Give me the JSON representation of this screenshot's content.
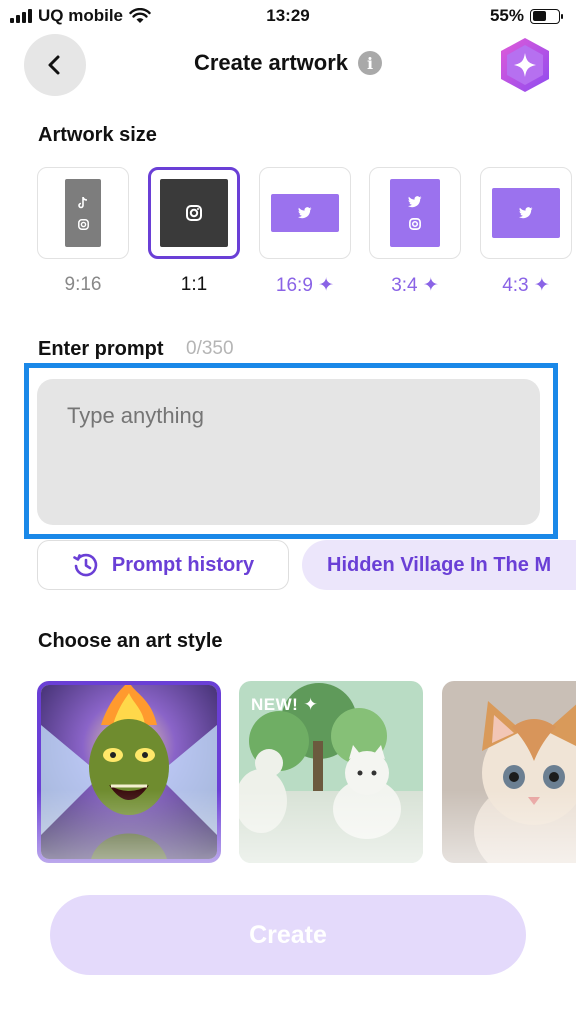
{
  "status_bar": {
    "carrier": "UQ mobile",
    "time": "13:29",
    "battery": "55%",
    "battery_level": 0.55
  },
  "header": {
    "title": "Create artwork",
    "info_icon": "i",
    "back_icon": "chevron-left-icon",
    "premium_icon": "sparkle-hexagon-icon"
  },
  "artwork_size": {
    "label": "Artwork size",
    "options": [
      {
        "label": "9:16",
        "tier": "free",
        "selected": false,
        "icons": [
          "tiktok-icon",
          "instagram-icon"
        ]
      },
      {
        "label": "1:1",
        "tier": "free",
        "selected": true,
        "icons": [
          "instagram-icon"
        ]
      },
      {
        "label": "16:9 ✦",
        "tier": "pro",
        "selected": false,
        "icons": [
          "twitter-icon"
        ]
      },
      {
        "label": "3:4 ✦",
        "tier": "pro",
        "selected": false,
        "icons": [
          "twitter-icon",
          "instagram-icon"
        ]
      },
      {
        "label": "4:3 ✦",
        "tier": "pro",
        "selected": false,
        "icons": [
          "twitter-icon"
        ]
      }
    ]
  },
  "prompt": {
    "label": "Enter prompt",
    "count": "0/350",
    "placeholder": "Type anything",
    "value": ""
  },
  "prompt_history": {
    "label": "Prompt history"
  },
  "suggestion_chip": {
    "label": "Hidden Village In The M"
  },
  "art_style": {
    "label": "Choose an art style",
    "badge_new": "NEW! ✦",
    "items": [
      "style-horror-ghoul",
      "style-anime-cats",
      "style-realistic-kitten"
    ]
  },
  "create_button": {
    "label": "Create"
  },
  "colors": {
    "accent": "#6a3fd6",
    "accent_light": "#8a63e6",
    "highlight": "#1a88e8",
    "create_disabled": "#e4dafb"
  }
}
